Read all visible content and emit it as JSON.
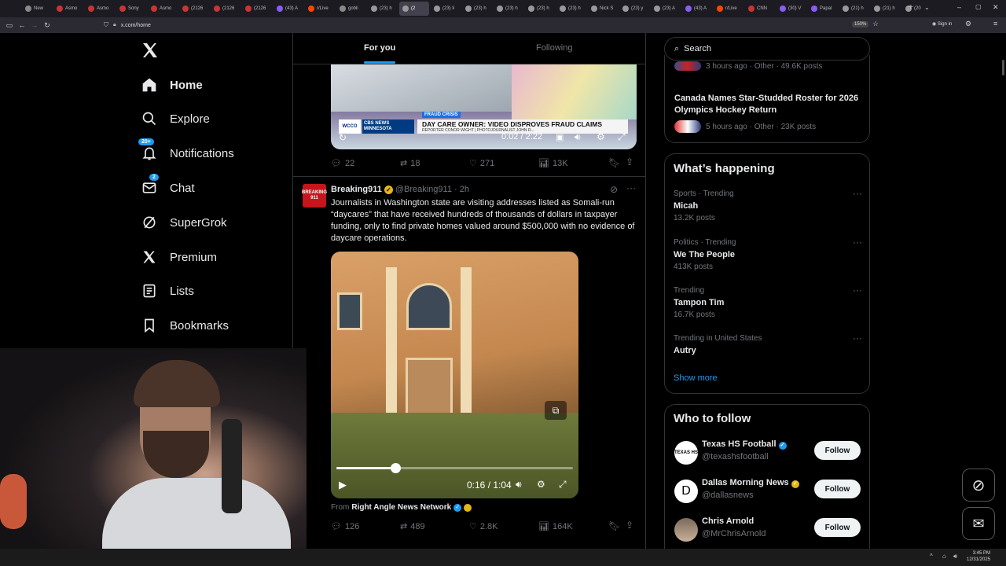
{
  "browser": {
    "tabs": [
      "New",
      "Asmo",
      "Asmo",
      "Sony",
      "Asmo",
      "(2126",
      "(2126",
      "(2126",
      "(43) A",
      "r/Live",
      "gobli",
      "(23) h",
      "(2",
      "(23) li",
      "(23) h",
      "(23) h",
      "(23) h",
      "(23) h",
      "Nick S",
      "(23) y",
      "(23) A",
      "(43) A",
      "r/Live",
      "CNN",
      "(30) V",
      "Papal",
      "(21) h",
      "(21) h",
      "(20"
    ],
    "url": "x.com/home",
    "zoom": "150%",
    "sign_in": "Sign in"
  },
  "sidebar": {
    "items": [
      {
        "label": "Home",
        "icon": "home-icon"
      },
      {
        "label": "Explore",
        "icon": "search-icon"
      },
      {
        "label": "Notifications",
        "icon": "bell-icon",
        "badge": "20+"
      },
      {
        "label": "Chat",
        "icon": "mail-icon",
        "badge": "2"
      },
      {
        "label": "SuperGrok",
        "icon": "grok-icon"
      },
      {
        "label": "Premium",
        "icon": "x-icon"
      },
      {
        "label": "Lists",
        "icon": "list-icon"
      },
      {
        "label": "Bookmarks",
        "icon": "bookmark-icon"
      }
    ]
  },
  "feed": {
    "tabs": [
      "For you",
      "Following"
    ],
    "post1": {
      "video_banner_tag": "FRAUD CRISIS",
      "video_network": "CBS NEWS MINNESOTA",
      "video_headline": "DAY CARE OWNER: VIDEO DISPROVES FRAUD CLAIMS",
      "video_subline": "REPORTER CONOR WIGHT | PHOTOJOURNALIST JOHN R...",
      "video_logo": "WCCO",
      "time": "0:02 / 2:22",
      "replies": "22",
      "reposts": "18",
      "likes": "271",
      "views": "13K"
    },
    "post2": {
      "author": "Breaking911",
      "handle": "@Breaking911 · 2h",
      "avatar_text": "BREAKING 911",
      "text": "Journalists in Washington state are visiting addresses listed as Somali-run “daycares” that have received hundreds of thousands of dollars in taxpayer funding, only to find private homes valued around $500,000 with no evidence of daycare operations.",
      "time": "0:16 / 1:04",
      "progress": 0.25,
      "from_label": "From",
      "from_source": "Right Angle News Network",
      "replies": "126",
      "reposts": "489",
      "likes": "2.8K",
      "views": "164K"
    }
  },
  "right": {
    "search_placeholder": "Search",
    "top_trends": [
      {
        "meta": "3 hours ago · Other · 49.6K posts"
      },
      {
        "title": "Canada Names Star-Studded Roster for 2026 Olympics Hockey Return",
        "meta": "5 hours ago · Other · 23K posts"
      }
    ],
    "happening_title": "What’s happening",
    "trends": [
      {
        "meta": "Sports · Trending",
        "name": "Micah",
        "posts": "13.2K posts"
      },
      {
        "meta": "Politics · Trending",
        "name": "We The People",
        "posts": "413K posts"
      },
      {
        "meta": "Trending",
        "name": "Tampon Tim",
        "posts": "16.7K posts"
      },
      {
        "meta": "Trending in United States",
        "name": "Autry",
        "posts": ""
      }
    ],
    "show_more": "Show more",
    "who_title": "Who to follow",
    "follow_label": "Follow",
    "who": [
      {
        "name": "Texas HS Football",
        "handle": "@texashsfootball",
        "avatar": "TEXAS HS"
      },
      {
        "name": "Dallas Morning News",
        "handle": "@dallasnews",
        "avatar": "D"
      },
      {
        "name": "Chris Arnold",
        "handle": "@MrChrisArnold",
        "avatar": ""
      }
    ]
  },
  "taskbar": {
    "time": "3:45 PM",
    "date": "12/31/2025"
  },
  "colors": {
    "accent": "#1d9bf0",
    "verified_gold": "#e2b719",
    "follow_bg": "#eff3f4"
  }
}
